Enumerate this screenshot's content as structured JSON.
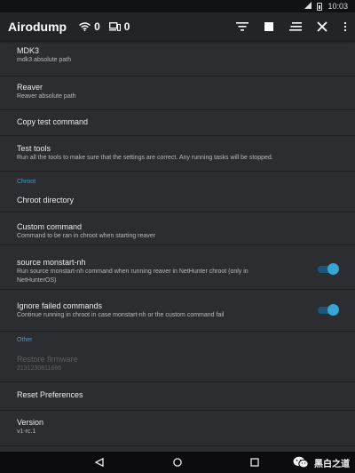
{
  "status_bar": {
    "time": "10:03"
  },
  "app_bar": {
    "title": "Airodump",
    "wifi_count": "0",
    "devices_count": "0",
    "action_icons": [
      "filter-icon",
      "stop-icon",
      "sort-icon",
      "close-icon",
      "overflow-icon"
    ]
  },
  "prefs": [
    {
      "title": "MDK3",
      "subtitle": "mdk3 absolute path"
    },
    {
      "title": "Reaver",
      "subtitle": "Reaver absolute path"
    },
    {
      "title": "Copy test command"
    },
    {
      "title": "Test tools",
      "subtitle": "Run all the tools to make sure that the settings are correct. Any running tasks will be stopped."
    },
    {
      "title": "Chroot directory"
    },
    {
      "title": "Custom command",
      "subtitle": "Command to be ran in chroot when starting reaver"
    },
    {
      "title": "source monstart-nh",
      "subtitle": "Run source monstart-nh command when running reaver in NetHunter chroot (only in",
      "subtitle2": "NetHunterOS)",
      "toggle": true
    },
    {
      "title": "Ignore failed commands",
      "subtitle": "Continue running in chroot in case monstart-nh or the custom command fail",
      "toggle": true
    },
    {
      "title": "Restore firmware",
      "subtitle": "2131230811686",
      "disabled": true
    },
    {
      "title": "Reset Preferences"
    },
    {
      "title": "Version",
      "subtitle": "v1-rc.1"
    }
  ],
  "categories": {
    "chroot": "Chroot",
    "other": "Other"
  },
  "watermark": "黑白之道",
  "colors": {
    "accent": "#33a6d6",
    "background": "#2b2d30",
    "appbar": "#232427"
  }
}
